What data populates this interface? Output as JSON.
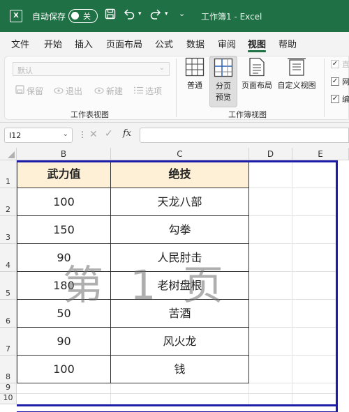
{
  "titlebar": {
    "logo": "X",
    "autosave_label": "自动保存",
    "autosave_state": "关",
    "doc_title": "工作簿1  -  Excel",
    "bg": "#1f7145"
  },
  "menu": {
    "tabs": [
      "文件",
      "开始",
      "插入",
      "页面布局",
      "公式",
      "数据",
      "审阅",
      "视图",
      "帮助"
    ],
    "active": "视图"
  },
  "ribbon": {
    "sheet_view": {
      "dropdown_value": "默认",
      "buttons": [
        "保留",
        "退出",
        "新建",
        "选项"
      ],
      "group_label": "工作表视图"
    },
    "workbook_views": {
      "buttons": [
        {
          "label": "普通",
          "icon": "grid-icon"
        },
        {
          "label": "分页\n预览",
          "icon": "page-break-icon",
          "selected": true
        },
        {
          "label": "页面布局",
          "icon": "page-layout-icon"
        },
        {
          "label": "自定义视图",
          "icon": "custom-view-icon"
        }
      ],
      "label_line1": "分页",
      "label_line2": "预览",
      "group_label": "工作簿视图"
    },
    "show": {
      "items": [
        {
          "label": "直",
          "checked": true,
          "disabled": true
        },
        {
          "label": "网",
          "checked": true,
          "disabled": false
        },
        {
          "label": "编",
          "checked": true,
          "disabled": false
        }
      ]
    }
  },
  "formula_bar": {
    "name_box": "I12",
    "fx": "fx",
    "value": ""
  },
  "grid": {
    "columns": [
      "B",
      "C",
      "D",
      "E"
    ],
    "rows": [
      "1",
      "2",
      "3",
      "4",
      "5",
      "6",
      "7",
      "8",
      "9",
      "10"
    ],
    "table": {
      "headers": [
        "武力值",
        "绝技"
      ],
      "rows": [
        [
          "100",
          "天龙八部"
        ],
        [
          "150",
          "勾拳"
        ],
        [
          "90",
          "人民肘击"
        ],
        [
          "180",
          "老树盘根"
        ],
        [
          "50",
          "苦酒"
        ],
        [
          "90",
          "风火龙"
        ],
        [
          "100",
          "钱"
        ]
      ]
    },
    "watermark": "第 1 页",
    "page_break_color": "#1c1ca8",
    "header_fill": "#fdf0d6"
  }
}
